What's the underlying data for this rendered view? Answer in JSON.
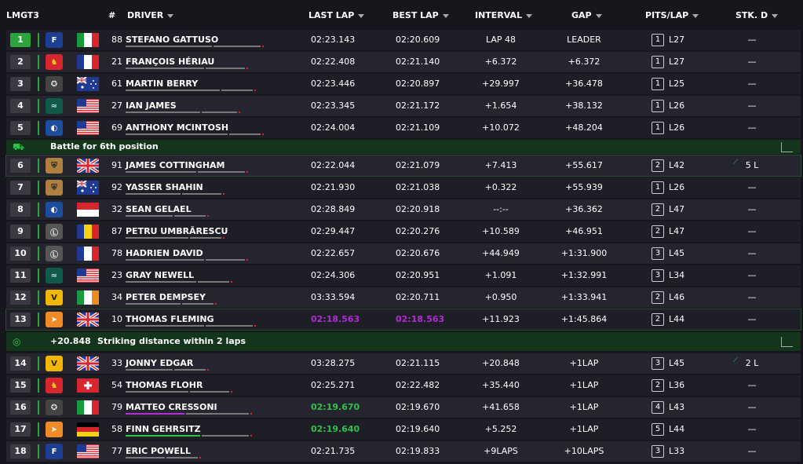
{
  "header": {
    "class": "LMGT3",
    "pos": "#",
    "driver": "DRIVER",
    "last_lap": "LAST LAP",
    "best_lap": "BEST LAP",
    "interval": "INTERVAL",
    "gap": "GAP",
    "pits_lap": "PITS/LAP",
    "stk": "STK. D"
  },
  "battles": [
    {
      "text": "Battle for 6th position"
    },
    {
      "gap": "+20.848",
      "text": "Striking distance within 2 laps"
    }
  ],
  "rows": [
    {
      "pos": "1",
      "num": "88",
      "driver": "STEFANO GATTUSO",
      "last": "02:23.143",
      "best": "02:20.609",
      "interval": "LAP 48",
      "gap": "LEADER",
      "pits": "1",
      "lap": "L27",
      "stk": "—",
      "brand": "ford",
      "flag": "it"
    },
    {
      "pos": "2",
      "num": "21",
      "driver": "FRANÇOIS HÉRIAU",
      "last": "02:22.408",
      "best": "02:21.140",
      "interval": "+6.372",
      "gap": "+6.372",
      "pits": "1",
      "lap": "L27",
      "stk": "—",
      "brand": "ferrari",
      "flag": "fr"
    },
    {
      "pos": "3",
      "num": "61",
      "driver": "MARTIN BERRY",
      "last": "02:23.446",
      "best": "02:20.897",
      "interval": "+29.997",
      "gap": "+36.478",
      "pits": "1",
      "lap": "L25",
      "stk": "—",
      "brand": "mercedes",
      "flag": "au"
    },
    {
      "pos": "4",
      "num": "27",
      "driver": "IAN JAMES",
      "last": "02:23.345",
      "best": "02:21.172",
      "interval": "+1.654",
      "gap": "+38.132",
      "pits": "1",
      "lap": "L26",
      "stk": "—",
      "brand": "aston",
      "flag": "us"
    },
    {
      "pos": "5",
      "num": "69",
      "driver": "ANTHONY MCINTOSH",
      "last": "02:24.004",
      "best": "02:21.109",
      "interval": "+10.072",
      "gap": "+48.204",
      "pits": "1",
      "lap": "L26",
      "stk": "—",
      "brand": "bmw",
      "flag": "us"
    },
    {
      "pos": "6",
      "num": "91",
      "driver": "JAMES COTTINGHAM",
      "last": "02:22.044",
      "best": "02:21.079",
      "interval": "+7.413",
      "gap": "+55.617",
      "pits": "2",
      "lap": "L42",
      "stk": "5 L",
      "brand": "porsche",
      "flag": "gb"
    },
    {
      "pos": "7",
      "num": "92",
      "driver": "YASSER SHAHIN",
      "last": "02:21.930",
      "best": "02:21.038",
      "interval": "+0.322",
      "gap": "+55.939",
      "pits": "1",
      "lap": "L26",
      "stk": "—",
      "brand": "porsche",
      "flag": "au"
    },
    {
      "pos": "8",
      "num": "32",
      "driver": "SEAN GELAEL",
      "last": "02:28.849",
      "best": "02:20.918",
      "interval": "--:--",
      "gap": "+36.362",
      "pits": "2",
      "lap": "L47",
      "stk": "—",
      "brand": "bmw",
      "flag": "id"
    },
    {
      "pos": "9",
      "num": "87",
      "driver": "PETRU UMBRĂRESCU",
      "last": "02:29.447",
      "best": "02:20.276",
      "interval": "+10.589",
      "gap": "+46.951",
      "pits": "2",
      "lap": "L47",
      "stk": "—",
      "brand": "lexus",
      "flag": "ro"
    },
    {
      "pos": "10",
      "num": "78",
      "driver": "HADRIEN DAVID",
      "last": "02:22.657",
      "best": "02:20.676",
      "interval": "+44.949",
      "gap": "+1:31.900",
      "pits": "3",
      "lap": "L45",
      "stk": "—",
      "brand": "lexus",
      "flag": "fr"
    },
    {
      "pos": "11",
      "num": "23",
      "driver": "GRAY NEWELL",
      "last": "02:24.306",
      "best": "02:20.951",
      "interval": "+1.091",
      "gap": "+1:32.991",
      "pits": "3",
      "lap": "L34",
      "stk": "—",
      "brand": "aston",
      "flag": "us"
    },
    {
      "pos": "12",
      "num": "34",
      "driver": "PETER DEMPSEY",
      "last": "03:33.594",
      "best": "02:20.711",
      "interval": "+0.950",
      "gap": "+1:33.941",
      "pits": "2",
      "lap": "L46",
      "stk": "—",
      "brand": "corvette",
      "flag": "ie"
    },
    {
      "pos": "13",
      "num": "10",
      "driver": "THOMAS FLEMING",
      "last": "02:18.563",
      "best": "02:18.563",
      "interval": "+11.923",
      "gap": "+1:45.864",
      "pits": "2",
      "lap": "L44",
      "stk": "—",
      "brand": "mclaren",
      "flag": "gb"
    },
    {
      "pos": "14",
      "num": "33",
      "driver": "JONNY EDGAR",
      "last": "03:28.275",
      "best": "02:21.115",
      "interval": "+20.848",
      "gap": "+1LAP",
      "pits": "3",
      "lap": "L45",
      "stk": "2 L",
      "brand": "corvette",
      "flag": "gb"
    },
    {
      "pos": "15",
      "num": "54",
      "driver": "THOMAS FLOHR",
      "last": "02:25.271",
      "best": "02:22.482",
      "interval": "+35.440",
      "gap": "+1LAP",
      "pits": "2",
      "lap": "L36",
      "stk": "—",
      "brand": "ferrari",
      "flag": "ch"
    },
    {
      "pos": "16",
      "num": "79",
      "driver": "MATTEO CRESSONI",
      "last": "02:19.670",
      "best": "02:19.670",
      "interval": "+41.658",
      "gap": "+1LAP",
      "pits": "4",
      "lap": "L43",
      "stk": "—",
      "brand": "mercedes",
      "flag": "it"
    },
    {
      "pos": "17",
      "num": "58",
      "driver": "FINN GEHRSITZ",
      "last": "02:19.640",
      "best": "02:19.640",
      "interval": "+5.252",
      "gap": "+1LAP",
      "pits": "5",
      "lap": "L44",
      "stk": "—",
      "brand": "mclaren",
      "flag": "de"
    },
    {
      "pos": "18",
      "num": "77",
      "driver": "ERIC POWELL",
      "last": "02:21.735",
      "best": "02:19.833",
      "interval": "+9LAPS",
      "gap": "+10LAPS",
      "pits": "3",
      "lap": "L33",
      "stk": "—",
      "brand": "ford",
      "flag": "us"
    }
  ],
  "colors": {
    "leader": "#2aa43b",
    "purple": "#b32bd6",
    "green": "#2ec24a",
    "battle_bg": "#12351b"
  }
}
